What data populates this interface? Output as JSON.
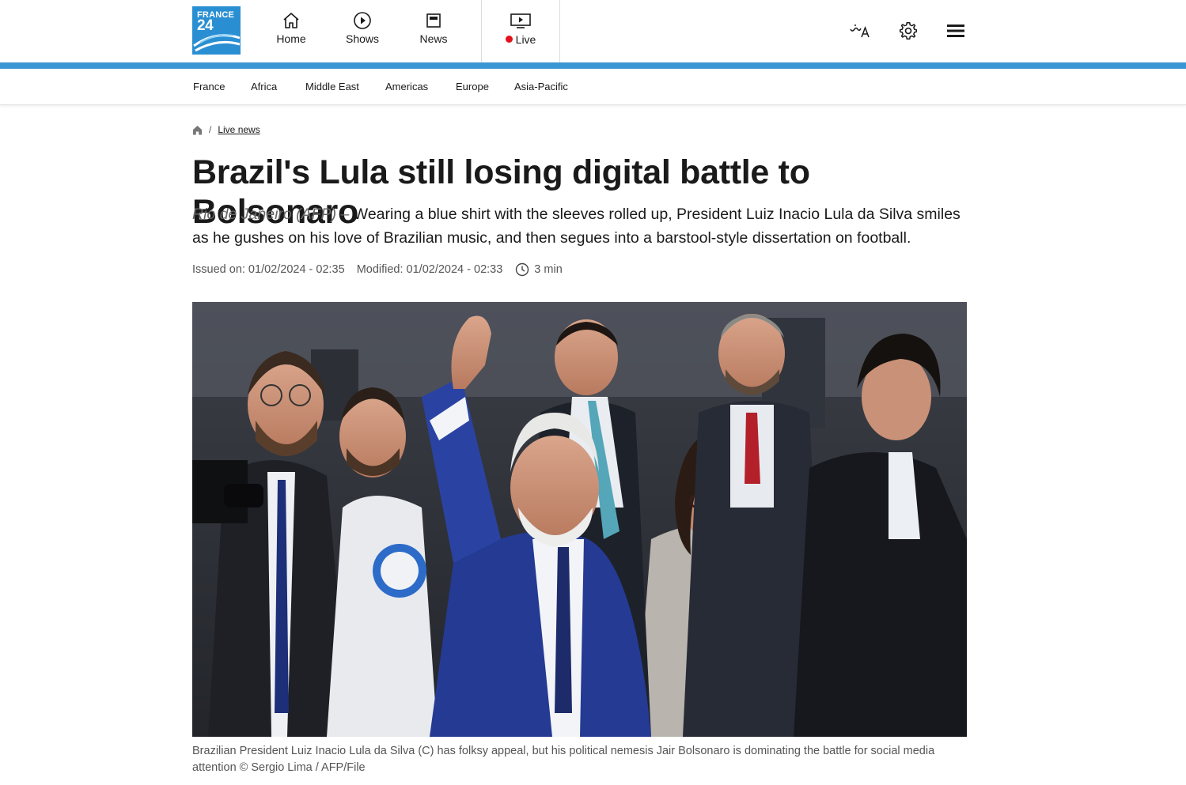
{
  "logo": {
    "line1": "FRANCE",
    "line2": "24"
  },
  "nav": {
    "home": "Home",
    "shows": "Shows",
    "news": "News",
    "live": "Live"
  },
  "sections": [
    "France",
    "Africa",
    "Middle East",
    "Americas",
    "Europe",
    "Asia-Pacific"
  ],
  "breadcrumb": {
    "separator": "/",
    "link": "Live news"
  },
  "article": {
    "title": "Brazil's Lula still losing digital battle to Bolsonaro",
    "dateline": "Rio de Janeiro (AFP) –",
    "lede": " Wearing a blue shirt with the sleeves rolled up, President Luiz Inacio Lula da Silva smiles as he gushes on his love of Brazilian music, and then segues into a barstool-style dissertation on football.",
    "issued": "Issued on: 01/02/2024 - 02:35",
    "modified": "Modified: 01/02/2024 - 02:33",
    "read_time": "3 min",
    "caption": "Brazilian President Luiz Inacio Lula da Silva (C) has folksy appeal, but his political nemesis Jair Bolsonaro is dominating the battle for social media attention © Sergio Lima / AFP/File"
  },
  "colors": {
    "brand_blue": "#3b97d3",
    "logo_blue": "#2a8fd2",
    "live_red": "#e3111b"
  }
}
